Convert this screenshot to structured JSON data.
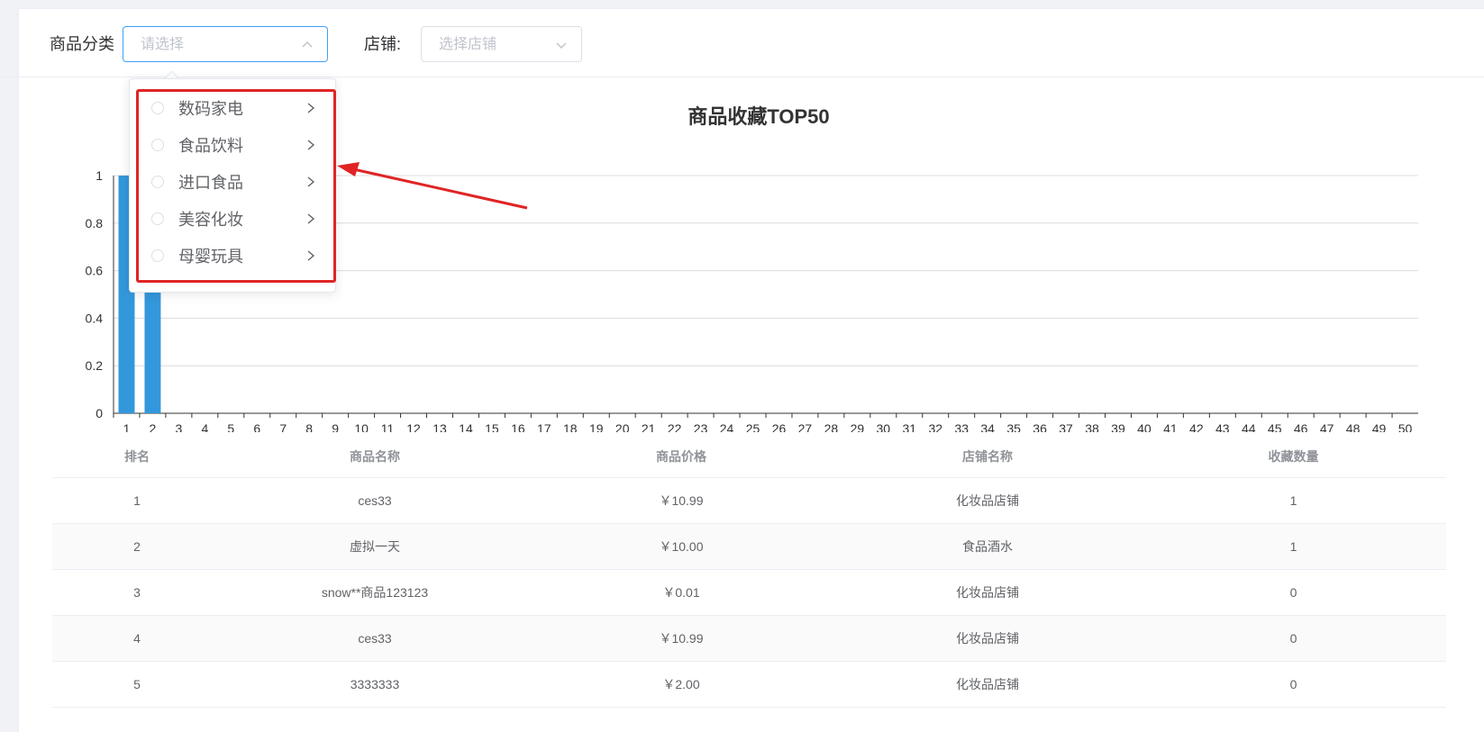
{
  "filters": {
    "category_label": "商品分类",
    "category_placeholder": "请选择",
    "shop_label": "店铺:",
    "shop_placeholder": "选择店铺"
  },
  "dropdown": {
    "options": [
      {
        "label": "数码家电"
      },
      {
        "label": "食品饮料"
      },
      {
        "label": "进口食品"
      },
      {
        "label": "美容化妆"
      },
      {
        "label": "母婴玩具"
      }
    ]
  },
  "chart_data": {
    "type": "bar",
    "title": "商品收藏TOP50",
    "categories": [
      "1",
      "2",
      "3",
      "4",
      "5",
      "6",
      "7",
      "8",
      "9",
      "10",
      "11",
      "12",
      "13",
      "14",
      "15",
      "16",
      "17",
      "18",
      "19",
      "20",
      "21",
      "22",
      "23",
      "24",
      "25",
      "26",
      "27",
      "28",
      "29",
      "30",
      "31",
      "32",
      "33",
      "34",
      "35",
      "36",
      "37",
      "38",
      "39",
      "40",
      "41",
      "42",
      "43",
      "44",
      "45",
      "46",
      "47",
      "48",
      "49",
      "50"
    ],
    "values": [
      1,
      1,
      0,
      0,
      0,
      0,
      0,
      0,
      0,
      0,
      0,
      0,
      0,
      0,
      0,
      0,
      0,
      0,
      0,
      0,
      0,
      0,
      0,
      0,
      0,
      0,
      0,
      0,
      0,
      0,
      0,
      0,
      0,
      0,
      0,
      0,
      0,
      0,
      0,
      0,
      0,
      0,
      0,
      0,
      0,
      0,
      0,
      0,
      0,
      0
    ],
    "ylim": [
      0,
      1
    ],
    "yticks": [
      "0",
      "0.2",
      "0.4",
      "0.6",
      "0.8",
      "1"
    ],
    "bar_color": "#3398db",
    "grid": true
  },
  "table": {
    "headers": [
      "排名",
      "商品名称",
      "商品价格",
      "店铺名称",
      "收藏数量"
    ],
    "rows": [
      [
        "1",
        "ces33",
        "￥10.99",
        "化妆品店铺",
        "1"
      ],
      [
        "2",
        "虚拟一天",
        "￥10.00",
        "食品酒水",
        "1"
      ],
      [
        "3",
        "snow**商品123123",
        "￥0.01",
        "化妆品店铺",
        "0"
      ],
      [
        "4",
        "ces33",
        "￥10.99",
        "化妆品店铺",
        "0"
      ],
      [
        "5",
        "3333333",
        "￥2.00",
        "化妆品店铺",
        "0"
      ]
    ]
  },
  "colors": {
    "accent": "#409eff",
    "bar": "#3398db",
    "annotation": "#e02424"
  }
}
